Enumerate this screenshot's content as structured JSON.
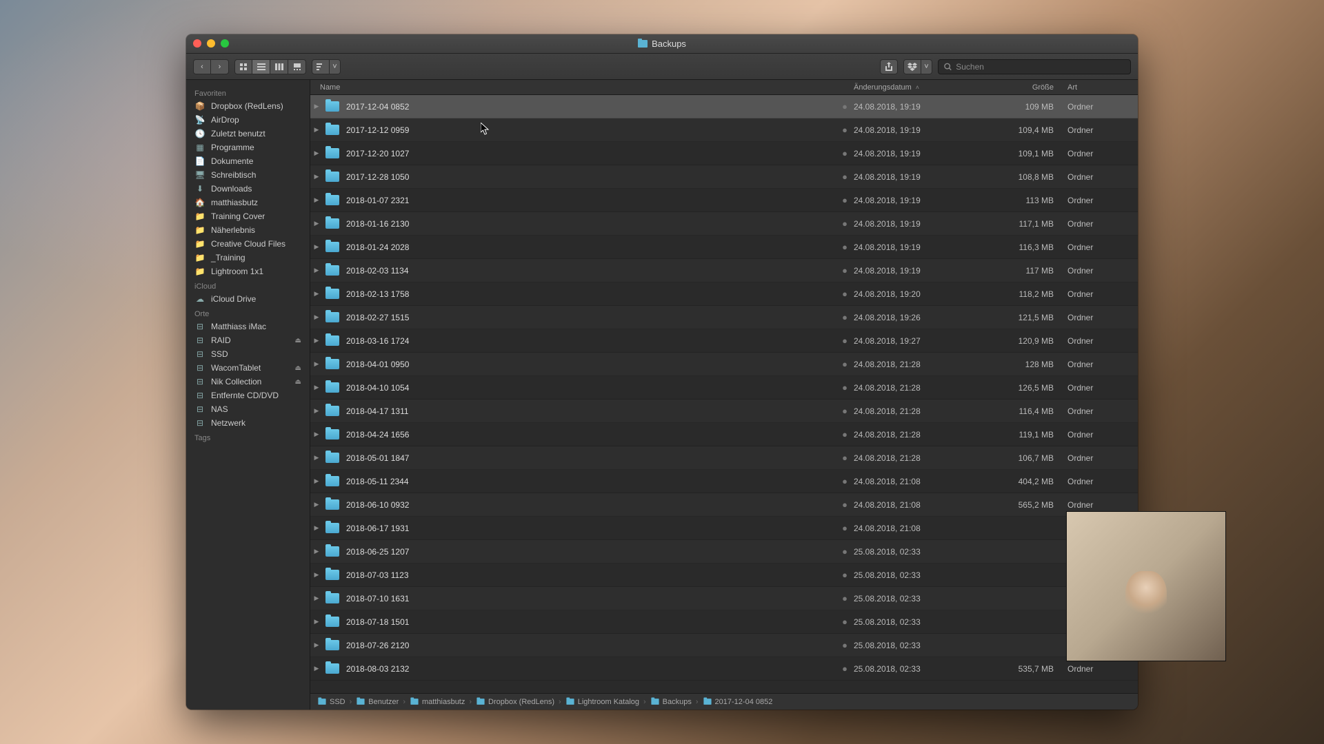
{
  "window": {
    "title": "Backups"
  },
  "search": {
    "placeholder": "Suchen"
  },
  "columns": {
    "name": "Name",
    "date": "Änderungsdatum",
    "size": "Größe",
    "kind": "Art"
  },
  "sidebar": {
    "favorites_label": "Favoriten",
    "favorites": [
      "Dropbox (RedLens)",
      "AirDrop",
      "Zuletzt benutzt",
      "Programme",
      "Dokumente",
      "Schreibtisch",
      "Downloads",
      "matthiasbutz",
      "Training Cover",
      "Näherlebnis",
      "Creative Cloud Files",
      "_Training",
      "Lightroom 1x1"
    ],
    "icloud_label": "iCloud",
    "icloud": [
      "iCloud Drive"
    ],
    "locations_label": "Orte",
    "locations": [
      {
        "name": "Matthiass iMac",
        "eject": false
      },
      {
        "name": "RAID",
        "eject": true
      },
      {
        "name": "SSD",
        "eject": false
      },
      {
        "name": "WacomTablet",
        "eject": true
      },
      {
        "name": "Nik Collection",
        "eject": true
      },
      {
        "name": "Entfernte CD/DVD",
        "eject": false
      },
      {
        "name": "NAS",
        "eject": false
      },
      {
        "name": "Netzwerk",
        "eject": false
      }
    ],
    "tags_label": "Tags"
  },
  "files": [
    {
      "name": "2017-12-04 0852",
      "date": "24.08.2018, 19:19",
      "size": "109 MB",
      "kind": "Ordner",
      "selected": true
    },
    {
      "name": "2017-12-12 0959",
      "date": "24.08.2018, 19:19",
      "size": "109,4 MB",
      "kind": "Ordner"
    },
    {
      "name": "2017-12-20 1027",
      "date": "24.08.2018, 19:19",
      "size": "109,1 MB",
      "kind": "Ordner"
    },
    {
      "name": "2017-12-28 1050",
      "date": "24.08.2018, 19:19",
      "size": "108,8 MB",
      "kind": "Ordner"
    },
    {
      "name": "2018-01-07 2321",
      "date": "24.08.2018, 19:19",
      "size": "113 MB",
      "kind": "Ordner"
    },
    {
      "name": "2018-01-16 2130",
      "date": "24.08.2018, 19:19",
      "size": "117,1 MB",
      "kind": "Ordner"
    },
    {
      "name": "2018-01-24 2028",
      "date": "24.08.2018, 19:19",
      "size": "116,3 MB",
      "kind": "Ordner"
    },
    {
      "name": "2018-02-03 1134",
      "date": "24.08.2018, 19:19",
      "size": "117 MB",
      "kind": "Ordner"
    },
    {
      "name": "2018-02-13 1758",
      "date": "24.08.2018, 19:20",
      "size": "118,2 MB",
      "kind": "Ordner"
    },
    {
      "name": "2018-02-27 1515",
      "date": "24.08.2018, 19:26",
      "size": "121,5 MB",
      "kind": "Ordner"
    },
    {
      "name": "2018-03-16 1724",
      "date": "24.08.2018, 19:27",
      "size": "120,9 MB",
      "kind": "Ordner"
    },
    {
      "name": "2018-04-01 0950",
      "date": "24.08.2018, 21:28",
      "size": "128 MB",
      "kind": "Ordner"
    },
    {
      "name": "2018-04-10 1054",
      "date": "24.08.2018, 21:28",
      "size": "126,5 MB",
      "kind": "Ordner"
    },
    {
      "name": "2018-04-17 1311",
      "date": "24.08.2018, 21:28",
      "size": "116,4 MB",
      "kind": "Ordner"
    },
    {
      "name": "2018-04-24 1656",
      "date": "24.08.2018, 21:28",
      "size": "119,1 MB",
      "kind": "Ordner"
    },
    {
      "name": "2018-05-01 1847",
      "date": "24.08.2018, 21:28",
      "size": "106,7 MB",
      "kind": "Ordner"
    },
    {
      "name": "2018-05-11 2344",
      "date": "24.08.2018, 21:08",
      "size": "404,2 MB",
      "kind": "Ordner"
    },
    {
      "name": "2018-06-10 0932",
      "date": "24.08.2018, 21:08",
      "size": "565,2 MB",
      "kind": "Ordner"
    },
    {
      "name": "2018-06-17 1931",
      "date": "24.08.2018, 21:08",
      "size": "",
      "kind": ""
    },
    {
      "name": "2018-06-25 1207",
      "date": "25.08.2018, 02:33",
      "size": "",
      "kind": ""
    },
    {
      "name": "2018-07-03 1123",
      "date": "25.08.2018, 02:33",
      "size": "",
      "kind": ""
    },
    {
      "name": "2018-07-10 1631",
      "date": "25.08.2018, 02:33",
      "size": "",
      "kind": ""
    },
    {
      "name": "2018-07-18 1501",
      "date": "25.08.2018, 02:33",
      "size": "",
      "kind": ""
    },
    {
      "name": "2018-07-26 2120",
      "date": "25.08.2018, 02:33",
      "size": "",
      "kind": ""
    },
    {
      "name": "2018-08-03 2132",
      "date": "25.08.2018, 02:33",
      "size": "535,7 MB",
      "kind": "Ordner"
    }
  ],
  "path": [
    "SSD",
    "Benutzer",
    "matthiasbutz",
    "Dropbox (RedLens)",
    "Lightroom Katalog",
    "Backups",
    "2017-12-04 0852"
  ]
}
